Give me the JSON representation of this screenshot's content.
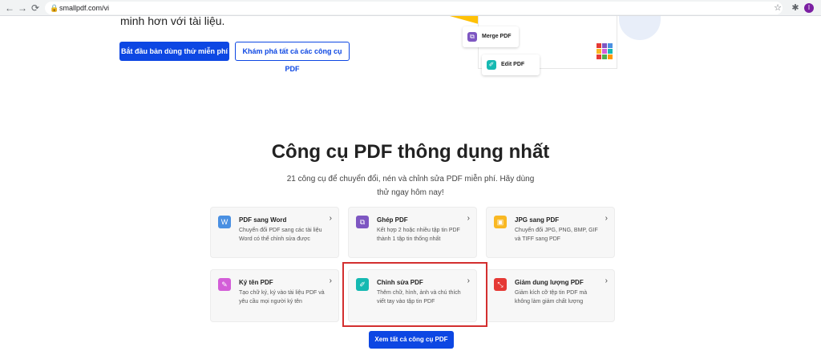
{
  "browser": {
    "url": "smallpdf.com/vi",
    "avatar_letter": "I",
    "back_icon": "←",
    "forward_icon": "→",
    "reload_icon": "⟳",
    "lock_icon": "🔒",
    "star_icon": "☆",
    "extensions_icon": "✱"
  },
  "hero": {
    "text": "minh hơn với tài liệu.",
    "primary_button": "Bắt đầu bản dùng thử miễn phí",
    "secondary_button": "Khám phá tất cả các công cụ PDF",
    "illustration": {
      "merge_label": "Merge PDF",
      "edit_label": "Edit PDF"
    }
  },
  "section": {
    "title": "Công cụ PDF thông dụng nhất",
    "subtitle": "21 công cụ để chuyển đổi, nén và chỉnh sửa PDF miễn phí. Hãy dùng thử ngay hôm nay!",
    "see_all_button": "Xem tất cả công cụ PDF"
  },
  "tools": [
    {
      "title": "PDF sang Word",
      "desc": "Chuyển đổi PDF sang các tài liệu Word có thể chỉnh sửa được",
      "icon": "word-icon",
      "color": "#4a90e2",
      "glyph": "W"
    },
    {
      "title": "Ghép PDF",
      "desc": "Kết hợp 2 hoặc nhiều tập tin PDF thành 1 tập tin thống nhất",
      "icon": "merge-icon",
      "color": "#7e57c2",
      "glyph": "⧉"
    },
    {
      "title": "JPG sang PDF",
      "desc": "Chuyển đổi JPG, PNG, BMP, GIF và TIFF sang PDF",
      "icon": "image-icon",
      "color": "#f9b823",
      "glyph": "▣"
    },
    {
      "title": "Ký tên PDF",
      "desc": "Tạo chữ ký, ký vào tài liệu PDF và yêu cầu mọi người ký tên",
      "icon": "sign-icon",
      "color": "#d35ed8",
      "glyph": "✎"
    },
    {
      "title": "Chỉnh sửa PDF",
      "desc": "Thêm chữ, hình, ảnh và chú thích viết tay vào tập tin PDF",
      "icon": "edit-icon",
      "color": "#16b9b2",
      "glyph": "✐"
    },
    {
      "title": "Giảm dung lượng PDF",
      "desc": "Giảm kích cỡ tệp tin PDF mà không làm giảm chất lượng",
      "icon": "compress-icon",
      "color": "#e53935",
      "glyph": "⤡"
    }
  ],
  "chevron": "›",
  "colors": {
    "brand_blue": "#0d47e3",
    "highlight_red": "#d32f2f"
  }
}
